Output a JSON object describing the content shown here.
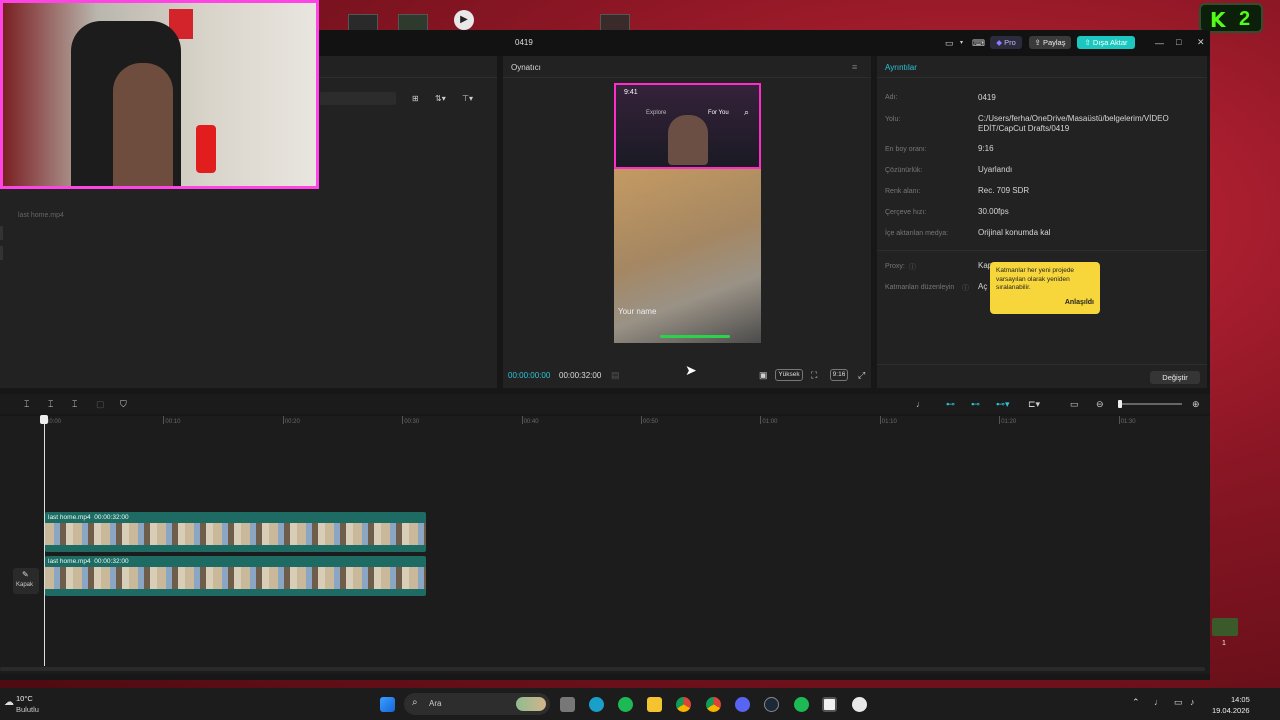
{
  "app": {
    "project_title": "0419"
  },
  "titlebar": {
    "pro_label": "Pro",
    "share_label": "Paylaş",
    "export_label": "Dışa Aktar"
  },
  "media": {
    "file_label": "last home.mp4"
  },
  "player": {
    "title": "Oynatıcı",
    "current_time": "00:00:00:00",
    "total_time": "00:00:32:00",
    "quality_label": "Yüksek",
    "ratio_label": "9:16",
    "phone": {
      "time": "9:41",
      "tab_explore": "Explore",
      "tab_foryou": "For You",
      "username": "Your name"
    }
  },
  "details": {
    "title": "Ayrıntılar",
    "rows": [
      {
        "label": "Adı:",
        "value": "0419"
      },
      {
        "label": "Yolu:",
        "value": "C:/Users/ferha/OneDrive/Masaüstü/belgelerim/VİDEO EDİT/CapCut Drafts/0419"
      },
      {
        "label": "En boy oranı:",
        "value": "9:16"
      },
      {
        "label": "Çözünürlük:",
        "value": "Uyarlandı"
      },
      {
        "label": "Renk alanı:",
        "value": "Rec. 709 SDR"
      },
      {
        "label": "Çerçeve hızı:",
        "value": "30.00fps"
      },
      {
        "label": "İçe aktarılan medya:",
        "value": "Orijinal konumda kal"
      }
    ],
    "proxy_label": "Proxy:",
    "proxy_value": "Kap",
    "layers_label": "Katmanları düzenleyin",
    "layers_value": "Aç",
    "tooltip_text": "Katmanlar her yeni projede varsayılan olarak yeniden sıralanabilir.",
    "tooltip_button": "Anlaşıldı",
    "modify_button": "Değiştir"
  },
  "timeline": {
    "ticks": [
      "00:00",
      "00:10",
      "00:20",
      "00:30",
      "00:40",
      "00:50",
      "01:00",
      "01:10",
      "01:20",
      "01:30"
    ],
    "clips": [
      {
        "name": "last home.mp4",
        "duration": "00:00:32:00"
      },
      {
        "name": "last home.mp4",
        "duration": "00:00:32:00"
      }
    ],
    "cover_label": "Kapak"
  },
  "overlay": {
    "kick_label": "2"
  },
  "taskbar": {
    "weather_temp": "10°C",
    "weather_desc": "Bulutlu",
    "search_placeholder": "Ara",
    "time": "14:05",
    "date": "19.04.2026",
    "badge_count": "1"
  }
}
